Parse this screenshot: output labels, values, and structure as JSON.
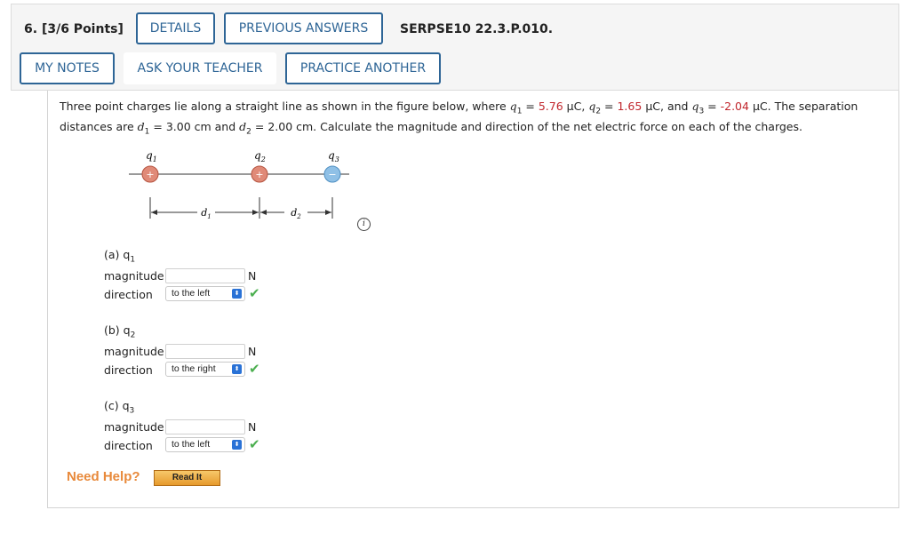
{
  "header": {
    "question_number": "6.",
    "points": "[3/6 Points]",
    "details_label": "DETAILS",
    "previous_answers_label": "PREVIOUS ANSWERS",
    "question_id": "SERPSE10 22.3.P.010.",
    "my_notes_label": "MY NOTES",
    "ask_teacher_label": "ASK YOUR TEACHER",
    "practice_another_label": "PRACTICE ANOTHER"
  },
  "problem": {
    "line1_a": "Three point charges lie along a straight line as shown in the figure below, where ",
    "q1_sym": "q",
    "q1_sub": "1",
    "q1_val": "5.76",
    "q2_val": "1.65",
    "q3_val": "-2.04",
    "unit": "μC",
    "line1_b": "The separation",
    "line2_a": "distances are ",
    "d1_val": "3.00 cm",
    "d2_val": "2.00 cm",
    "line2_b": ". Calculate the magnitude and direction of the net electric force on each of the charges."
  },
  "figure": {
    "q1_label": "q1",
    "q2_label": "q2",
    "q3_label": "q3",
    "d1_label": "d1",
    "d2_label": "d2",
    "plus": "+",
    "minus": "−"
  },
  "parts": [
    {
      "title": "(a) q",
      "sub": "1",
      "magnitude_label": "magnitude",
      "unit": "N",
      "direction_label": "direction",
      "direction_value": "to the left"
    },
    {
      "title": "(b) q",
      "sub": "2",
      "magnitude_label": "magnitude",
      "unit": "N",
      "direction_label": "direction",
      "direction_value": "to the right"
    },
    {
      "title": "(c) q",
      "sub": "3",
      "magnitude_label": "magnitude",
      "unit": "N",
      "direction_label": "direction",
      "direction_value": "to the left"
    }
  ],
  "help": {
    "need_help": "Need Help?",
    "read_it": "Read It"
  },
  "colors": {
    "accent": "#2e6596",
    "value_red": "#c1272d",
    "check_green": "#4caf50",
    "help_orange": "#e8893a"
  }
}
